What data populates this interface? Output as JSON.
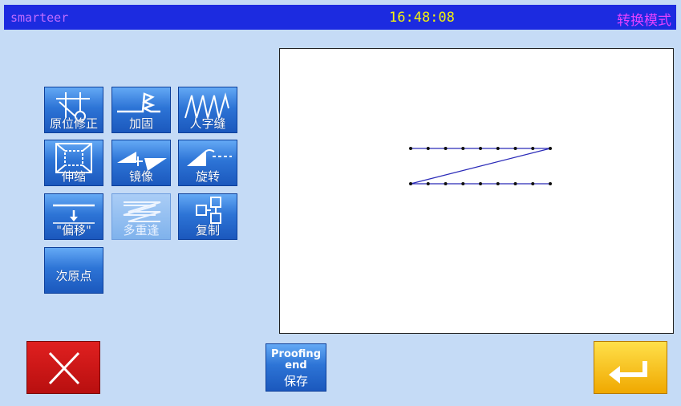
{
  "header": {
    "brand": "smarteer",
    "time": "16:48:08",
    "mode": "转换模式"
  },
  "colors": {
    "topbar": "#1c2be0",
    "background": "#c5dbf6",
    "clock": "#f5f20a",
    "brand": "#c06cff",
    "mode": "#e542ff",
    "stitch_line": "#2a2ab8",
    "cancel": "#d01818",
    "enter": "#f6c21a"
  },
  "tools": {
    "origin_correction": {
      "label": "原位修正",
      "icon": "origin-correction-icon"
    },
    "reinforce": {
      "label": "加固",
      "icon": "reinforce-icon"
    },
    "zigzag": {
      "label": "人字缝",
      "icon": "zigzag-icon"
    },
    "scale": {
      "label": "伸缩",
      "icon": "scale-icon"
    },
    "mirror": {
      "label": "镜像",
      "icon": "mirror-icon"
    },
    "rotate": {
      "label": "旋转",
      "icon": "rotate-icon"
    },
    "offset": {
      "label": "\"偏移\"",
      "icon": "offset-icon"
    },
    "multi_stitch": {
      "label": "多重逢",
      "icon": "multi-stitch-icon",
      "enabled": false
    },
    "copy": {
      "label": "复制",
      "icon": "copy-icon"
    },
    "secondary_origin": {
      "label": "次原点",
      "icon": ""
    }
  },
  "footer": {
    "cancel_icon": "close-icon",
    "proof_line1": "Proofing",
    "proof_line2": "end",
    "proof_line3": "保存",
    "enter_icon": "enter-return-icon"
  }
}
